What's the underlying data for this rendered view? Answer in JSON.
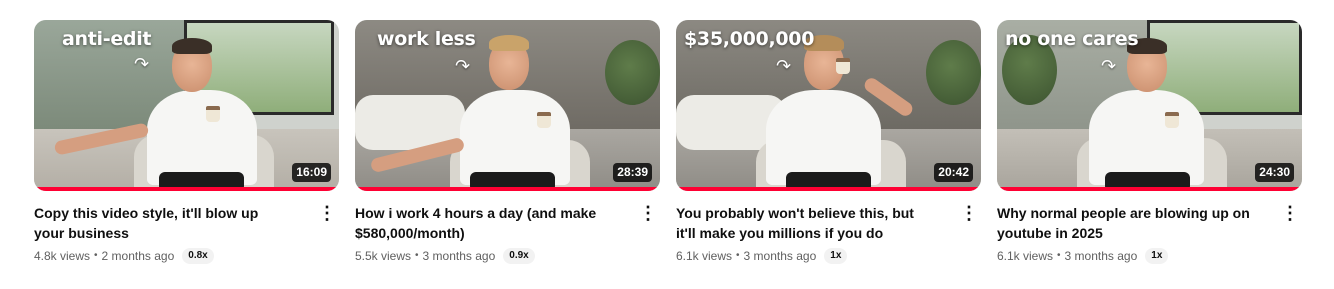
{
  "colors": {
    "progress": "#ff0033",
    "text": "#0f0f0f",
    "meta": "#606060"
  },
  "icons": {
    "more": "more-vert-icon"
  },
  "videos": [
    {
      "overlay_text": "anti-edit",
      "duration": "16:09",
      "title": "Copy this video style, it'll blow up your business",
      "views": "4.8k views",
      "age": "2 months ago",
      "speed": "0.8x",
      "watched_fraction": 1.0
    },
    {
      "overlay_text": "work less",
      "duration": "28:39",
      "title": "How i work 4 hours a day (and make $580,000/month)",
      "views": "5.5k views",
      "age": "3 months ago",
      "speed": "0.9x",
      "watched_fraction": 1.0
    },
    {
      "overlay_text": "$35,000,000",
      "duration": "20:42",
      "title": "You probably won't believe this, but it'll make you millions if you do",
      "views": "6.1k views",
      "age": "3 months ago",
      "speed": "1x",
      "watched_fraction": 1.0
    },
    {
      "overlay_text": "no one cares",
      "duration": "24:30",
      "title": "Why normal people are blowing up on youtube in 2025",
      "views": "6.1k views",
      "age": "3 months ago",
      "speed": "1x",
      "watched_fraction": 1.0
    }
  ]
}
